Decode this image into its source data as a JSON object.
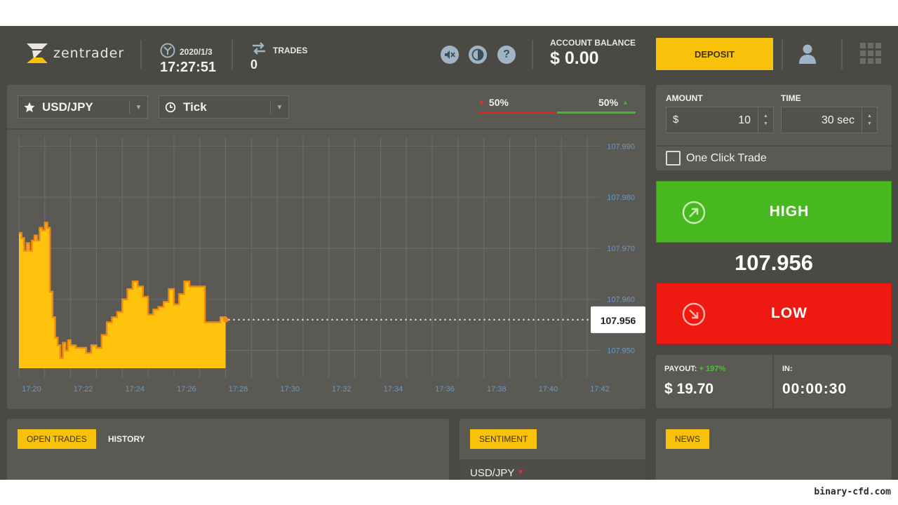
{
  "header": {
    "logo_text": "zentrader",
    "date": "2020/1/3",
    "time": "17:27:51",
    "trades_label": "TRADES",
    "trades_count": "0",
    "balance_label": "ACCOUNT BALANCE",
    "balance_value": "$ 0.00",
    "deposit_label": "DEPOSIT",
    "icons": [
      "mute-icon",
      "contrast-icon",
      "help-icon",
      "user-icon",
      "apps-grid-icon"
    ]
  },
  "toolbar": {
    "asset": "USD/JPY",
    "chart_type": "Tick",
    "sentiment_down": "50%",
    "sentiment_up": "50%",
    "sentiment_down_fraction": 0.5
  },
  "trade": {
    "amount_label": "AMOUNT",
    "amount_currency": "$",
    "amount_value": "10",
    "time_label": "TIME",
    "time_value": "30 sec",
    "one_click_label": "One Click Trade",
    "high_label": "HIGH",
    "low_label": "LOW",
    "current_price": "107.956",
    "payout_label": "PAYOUT:",
    "payout_pct": "+ 197%",
    "payout_value": "$ 19.70",
    "in_label": "IN:",
    "in_value": "00:00:30"
  },
  "bottom": {
    "open_trades": "OPEN TRADES",
    "history": "HISTORY",
    "sentiment": "SENTIMENT",
    "sentiment_pair": "USD/JPY",
    "news": "NEWS"
  },
  "watermark": "binary-cfd.com",
  "colors": {
    "background": "#4a4944",
    "panel": "#5a5953",
    "accent": "#f9c20a",
    "high": "#47b820",
    "low": "#ee1a12",
    "chart_fill": "#ffc20d",
    "chart_line": "#f08a12",
    "axis_text": "#6b99c7"
  },
  "chart_data": {
    "type": "area",
    "x_tick_labels": [
      "17:20",
      "17:22",
      "17:24",
      "17:26",
      "17:28",
      "17:30",
      "17:32",
      "17:34",
      "17:36",
      "17:38",
      "17:40",
      "17:42"
    ],
    "y_tick_labels": [
      "107.990",
      "107.980",
      "107.970",
      "107.960",
      "107.950"
    ],
    "xlim": [
      0,
      22
    ],
    "ylim": [
      107.9465,
      107.991
    ],
    "grid": true,
    "current_value": 107.956,
    "current_value_label": "107.956",
    "x": [
      0,
      0.1,
      0.2,
      0.3,
      0.4,
      0.5,
      0.6,
      0.7,
      0.8,
      0.9,
      1.0,
      1.1,
      1.2,
      1.3,
      1.4,
      1.5,
      1.6,
      1.7,
      1.8,
      1.9,
      2.0,
      2.2,
      2.4,
      2.6,
      2.8,
      3.0,
      3.2,
      3.4,
      3.6,
      3.8,
      4.0,
      4.2,
      4.4,
      4.6,
      4.8,
      5.0,
      5.2,
      5.4,
      5.6,
      5.8,
      6.0,
      6.2,
      6.4,
      6.6,
      6.8,
      7.0,
      7.2,
      7.4,
      7.6,
      7.8,
      8.0
    ],
    "y": [
      107.973,
      107.972,
      107.9695,
      107.971,
      107.9695,
      107.9715,
      107.9725,
      107.9715,
      107.974,
      107.9735,
      107.975,
      107.974,
      107.9615,
      107.9565,
      107.9525,
      107.951,
      107.9485,
      107.9515,
      107.95,
      107.952,
      107.951,
      107.9505,
      107.9505,
      107.9495,
      107.951,
      107.9505,
      107.953,
      107.9555,
      107.9565,
      107.9575,
      107.96,
      107.962,
      107.9635,
      107.9625,
      107.9605,
      107.957,
      107.958,
      107.9585,
      107.9595,
      107.962,
      107.959,
      107.961,
      107.9635,
      107.9625,
      107.9625,
      107.9625,
      107.9555,
      107.9555,
      107.9555,
      107.9565,
      107.956
    ]
  }
}
